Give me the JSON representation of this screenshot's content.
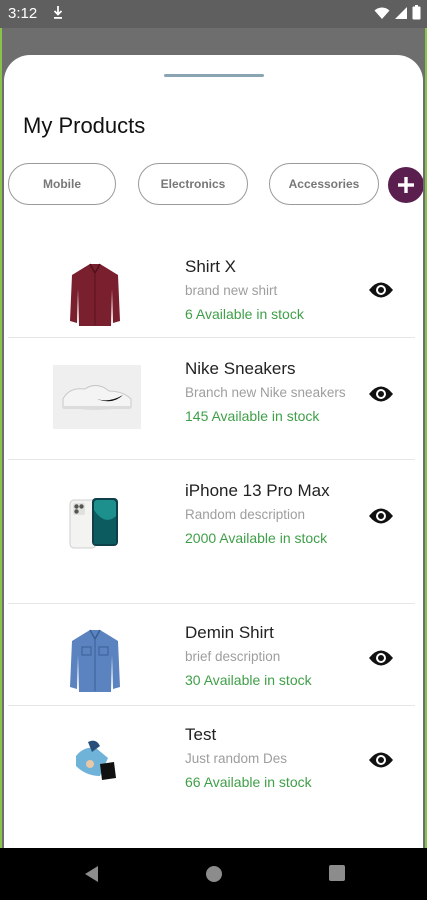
{
  "status_bar": {
    "time": "3:12",
    "icons": [
      "download-icon",
      "wifi-icon",
      "cellular-icon",
      "battery-icon"
    ]
  },
  "sheet": {
    "title": "My Products",
    "categories": [
      "Mobile",
      "Electronics",
      "Accessories"
    ],
    "add_button_icon": "plus-icon",
    "accent_color": "#5a1f4f",
    "stock_color": "#3f9f48"
  },
  "products": [
    {
      "name": "Shirt X",
      "description": "brand new shirt",
      "stock": "6 Available in stock",
      "image": "maroon-shirt"
    },
    {
      "name": "Nike Sneakers",
      "description": "Branch new Nike sneakers",
      "stock": "145 Available in stock",
      "image": "white-sneakers"
    },
    {
      "name": "iPhone 13 Pro Max",
      "description": "Random description",
      "stock": "2000 Available in stock",
      "image": "iphone"
    },
    {
      "name": "Demin Shirt",
      "description": "brief description",
      "stock": "30 Available in stock",
      "image": "denim-shirt"
    },
    {
      "name": "Test",
      "description": "Just random Des",
      "stock": "66 Available in stock",
      "image": "misc-photo"
    }
  ],
  "nav_bar": {
    "icons": [
      "back-icon",
      "home-icon",
      "recents-icon"
    ]
  }
}
